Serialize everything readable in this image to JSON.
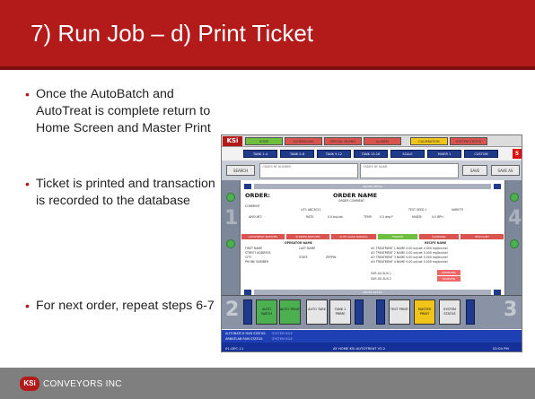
{
  "slide": {
    "title": "7) Run Job – d) Print Ticket",
    "bullets": [
      "Once the AutoBatch and AutoTreat is complete return to Home Screen and Master Print",
      "Ticket is printed and transaction is recorded to the database",
      "For next order, repeat steps 6-7"
    ],
    "footer_company": "CONVEYORS INC",
    "footer_logo_text": "KSi",
    "colors": {
      "title_bg": "#b31b1b",
      "footer_bg": "#7f7f7f",
      "bullet": "#b31b1b"
    }
  },
  "hmi": {
    "logo": "KSi",
    "top_buttons": [
      {
        "label": "HOME",
        "color": "#6fbf3f"
      },
      {
        "label": "SCHEDULING",
        "color": "#d9534f"
      },
      {
        "label": "SPECIAL MIXING",
        "color": "#d9534f"
      },
      {
        "label": "ALARMS",
        "color": "#d9534f"
      },
      {
        "label": "CALIBRATION",
        "color": "#f0c419"
      },
      {
        "label": "SYSTEM STATUS",
        "color": "#d9534f"
      }
    ],
    "nav_tabs": [
      "TANK 1-4",
      "TANK 5-8",
      "TANK 9-12",
      "TANK 13-16",
      "SCALE",
      "MIXER 1",
      "CUSTOM"
    ],
    "nav_red": "5",
    "search_label": "SEARCH",
    "search_box_1": "ORDER BY NUMBER",
    "search_box_2": "ORDER BY NAME",
    "side_buttons": [
      "SAVE",
      "SAVE AS"
    ],
    "header_bar": "ORDER DETAIL",
    "order_label": "ORDER:",
    "order_name_label": "ORDER NAME",
    "order_comment": "ORDER COMMENT",
    "fields_row1": [
      "COMMENT",
      "LOT: ABC3021",
      "TEST SEED 1",
      "VARIETY"
    ],
    "fields_row2": [
      "AMOUNT:",
      "RATE:",
      "0.0 bu/cwt",
      "TEMP:",
      "0.0 deg F",
      "MIXED:",
      "0.0 BPH"
    ],
    "status_segments": [
      {
        "label": "AUTOTREAT BATCHES",
        "color": "#d9534f"
      },
      {
        "label": "SHARED BATCHES",
        "color": "#d9534f"
      },
      {
        "label": "AUTO LOAD MANUAL",
        "color": "#d9534f"
      },
      {
        "label": "FORCED",
        "color": "#6fbf3f"
      },
      {
        "label": "SAMPLING",
        "color": "#d9534f"
      },
      {
        "label": "DISCOUNT",
        "color": "#d9534f"
      }
    ],
    "operator_header": "OPERATOR NAME",
    "operator_fields": [
      "FIRST NAME",
      "LAST NAME",
      "STREET ADDRESS",
      "CITY",
      "STATE",
      "ZIP/PIN",
      "PHONE NUMBER"
    ],
    "recipe_header": "RECIPE NAME",
    "recipe_lines": [
      "#1 TREATMENT 1 NAME    0.00 oz/cwt  0.000 mg/bushel",
      "#2 TREATMENT 2 NAME    0.00 oz/cwt  0.000 mg/bushel",
      "#3 TREATMENT 3 NAME    0.00 oz/cwt  0.000 mg/bushel",
      "#4 TREATMENT 4 NAME    0.00 oz/cwt  0.000 mg/bushel"
    ],
    "recipe_aux": [
      "SUR AG AUX 1",
      "SUR AG AUX 2"
    ],
    "pink_labels": [
      "PREMIXING",
      "TRANSFER"
    ],
    "bottom_bar": "ORDER DETAIL",
    "lane_left_num": "2",
    "lane_right_num": "3",
    "lane_buttons_left": [
      {
        "label": "AUTO BATCH",
        "color": "#4caf50"
      },
      {
        "label": "AUTO TREAT",
        "color": "#4caf50"
      },
      {
        "label": "AUTO TARE",
        "color": "#e6e6e6"
      },
      {
        "label": "TANK 1 PRIME",
        "color": "#e6e6e6"
      }
    ],
    "lane_buttons_right": [
      {
        "label": "TEST PRINT",
        "color": "#e6e6e6"
      },
      {
        "label": "MASTER PRINT",
        "color": "#f0c419"
      },
      {
        "label": "SYSTEM STATUS",
        "color": "#e6e6e6"
      }
    ],
    "status_label_1": "AUTOBATCH RUN STATUS:",
    "status_value_1": "SYSTEM IDLE",
    "status_label_2": "ARBATLAB RUN STATUS:",
    "status_value_2": "SYSTEM IDLE",
    "footer_date": "01-DEC-11",
    "footer_title": "AY HOME KSi AUTOTREAT V3.2",
    "footer_time": "02:04 PM"
  }
}
